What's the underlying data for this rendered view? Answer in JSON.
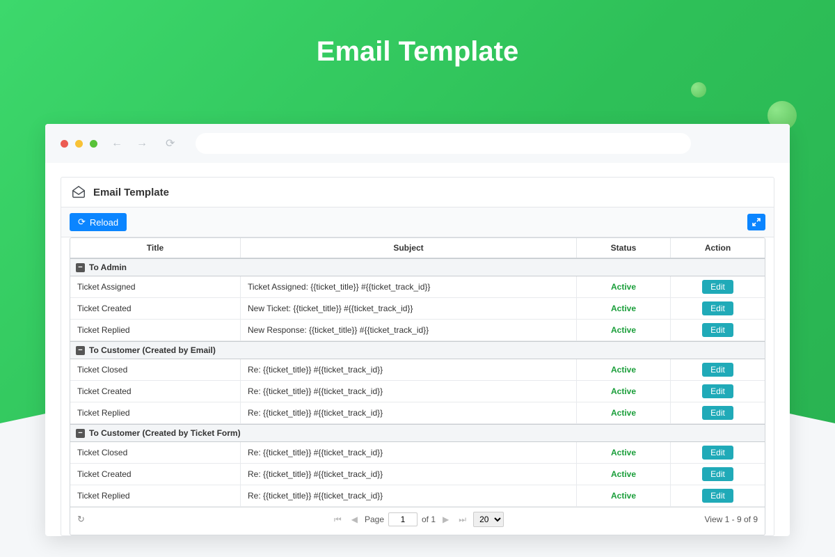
{
  "pageTitle": "Email Template",
  "panel": {
    "title": "Email Template",
    "reloadLabel": "Reload"
  },
  "columns": {
    "title": "Title",
    "subject": "Subject",
    "status": "Status",
    "action": "Action"
  },
  "statusLabel": "Active",
  "editLabel": "Edit",
  "collapseGlyph": "−",
  "groups": [
    {
      "name": "To Admin",
      "rows": [
        {
          "title": "Ticket Assigned",
          "subject": "Ticket Assigned: {{ticket_title}} #{{ticket_track_id}}"
        },
        {
          "title": "Ticket Created",
          "subject": "New Ticket: {{ticket_title}} #{{ticket_track_id}}"
        },
        {
          "title": "Ticket Replied",
          "subject": "New Response: {{ticket_title}} #{{ticket_track_id}}"
        }
      ]
    },
    {
      "name": "To Customer (Created by Email)",
      "rows": [
        {
          "title": "Ticket Closed",
          "subject": "Re: {{ticket_title}} #{{ticket_track_id}}"
        },
        {
          "title": "Ticket Created",
          "subject": "Re: {{ticket_title}} #{{ticket_track_id}}"
        },
        {
          "title": "Ticket Replied",
          "subject": "Re: {{ticket_title}} #{{ticket_track_id}}"
        }
      ]
    },
    {
      "name": "To Customer (Created by Ticket Form)",
      "rows": [
        {
          "title": "Ticket Closed",
          "subject": "Re: {{ticket_title}} #{{ticket_track_id}}"
        },
        {
          "title": "Ticket Created",
          "subject": "Re: {{ticket_title}} #{{ticket_track_id}}"
        },
        {
          "title": "Ticket Replied",
          "subject": "Re: {{ticket_title}} #{{ticket_track_id}}"
        }
      ]
    }
  ],
  "pager": {
    "pageLabel": "Page",
    "pageValue": "1",
    "ofLabel": "of 1",
    "perPage": "20",
    "viewText": "View 1 - 9 of 9"
  }
}
